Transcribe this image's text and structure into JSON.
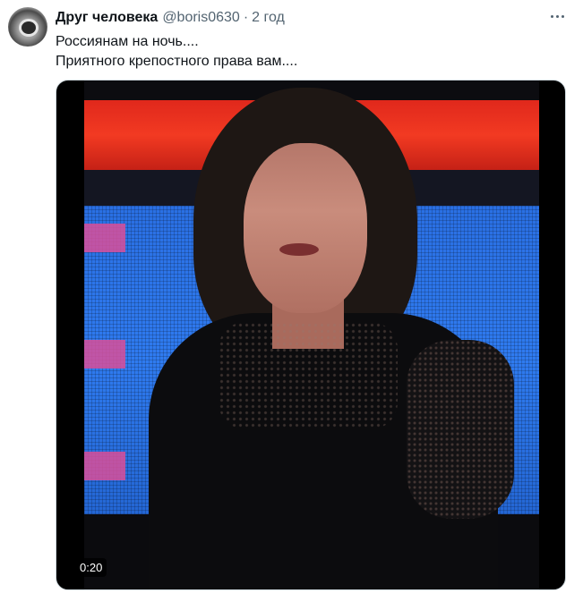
{
  "tweet": {
    "display_name": "Друг человека",
    "handle": "@boris0630",
    "separator": "·",
    "time": "2 год",
    "lines": [
      "Россиянам на ночь....",
      "Приятного крепостного права вам...."
    ],
    "more_icon": "more-horizontal-icon",
    "video": {
      "duration": "0:20"
    }
  },
  "colors": {
    "text_primary": "#0f1419",
    "text_secondary": "#536471",
    "media_border": "#cfd9de"
  }
}
